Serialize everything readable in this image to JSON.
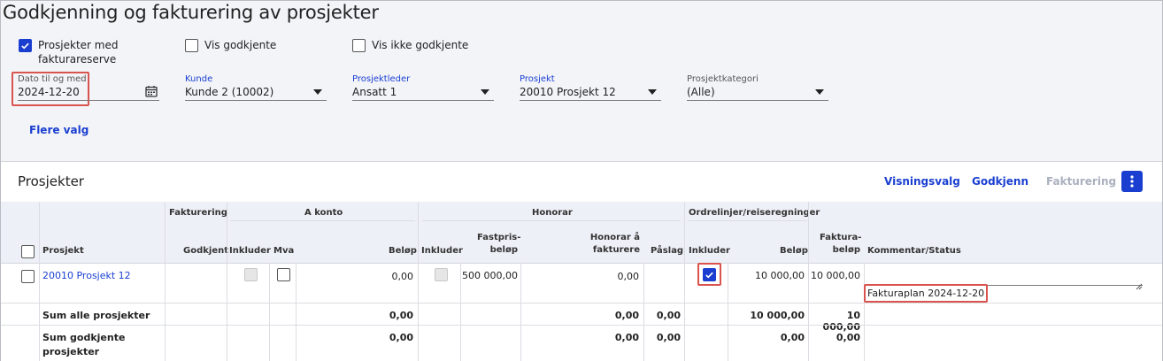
{
  "page": {
    "title": "Godkjenning og fakturering av prosjekter"
  },
  "filters": {
    "chk_fakturareserve": {
      "label1": "Prosjekter med",
      "label2": "fakturareserve",
      "checked": true
    },
    "chk_godkjente": {
      "label": "Vis godkjente",
      "checked": false
    },
    "chk_ikke_godkjente": {
      "label": "Vis ikke godkjente",
      "checked": false
    },
    "dato": {
      "label": "Dato til og med",
      "value": "2024-12-20"
    },
    "kunde": {
      "label": "Kunde",
      "value": "Kunde 2 (10002)"
    },
    "prosjektleder": {
      "label": "Prosjektleder",
      "value": "Ansatt 1"
    },
    "prosjekt": {
      "label": "Prosjekt",
      "value": "20010 Prosjekt 12"
    },
    "kategori": {
      "label": "Prosjektkategori",
      "value": "(Alle)"
    },
    "flere_valg": "Flere valg"
  },
  "panel": {
    "title": "Prosjekter",
    "visningsvalg": "Visningsvalg",
    "godkjenn": "Godkjenn",
    "fakturering": "Fakturering"
  },
  "table": {
    "groups": {
      "fakturering": "Fakturering",
      "akonto": "A konto",
      "honorar": "Honorar",
      "ordrelinjer": "Ordrelinjer/reiseregninger"
    },
    "cols": {
      "prosjekt": "Prosjekt",
      "godkjent": "Godkjent",
      "ak_inkluder": "Inkluder",
      "ak_mva": "Mva",
      "ak_belop": "Beløp",
      "ho_inkluder": "Inkluder",
      "fastpris1": "Fastpris-",
      "fastpris2": "beløp",
      "hon1": "Honorar å",
      "hon2": "fakturere",
      "paslag": "Påslag",
      "or_inkluder": "Inkluder",
      "or_belop": "Beløp",
      "fb1": "Faktura-",
      "fb2": "beløp",
      "kommentar": "Kommentar/Status"
    },
    "row": {
      "prosjekt": "20010 Prosjekt 12",
      "ak_belop": "0,00",
      "fastpris": "500 000,00",
      "honorar": "0,00",
      "or_belop": "10 000,00",
      "fakturabelop": "10 000,00",
      "status": "Fakturaplan 2024-12-20"
    },
    "sum_alle": {
      "label": "Sum alle prosjekter",
      "ak_belop": "0,00",
      "honorar": "0,00",
      "paslag": "0,00",
      "or_belop": "10 000,00",
      "fakturabelop": "10 000,00"
    },
    "sum_godkjente": {
      "label1": "Sum godkjente",
      "label2": "prosjekter",
      "ak_belop": "0,00",
      "honorar": "0,00",
      "paslag": "0,00",
      "or_belop": "0,00",
      "fakturabelop": "0,00"
    }
  },
  "colors": {
    "accent": "#1a3fd0",
    "highlight": "#d9534f"
  }
}
